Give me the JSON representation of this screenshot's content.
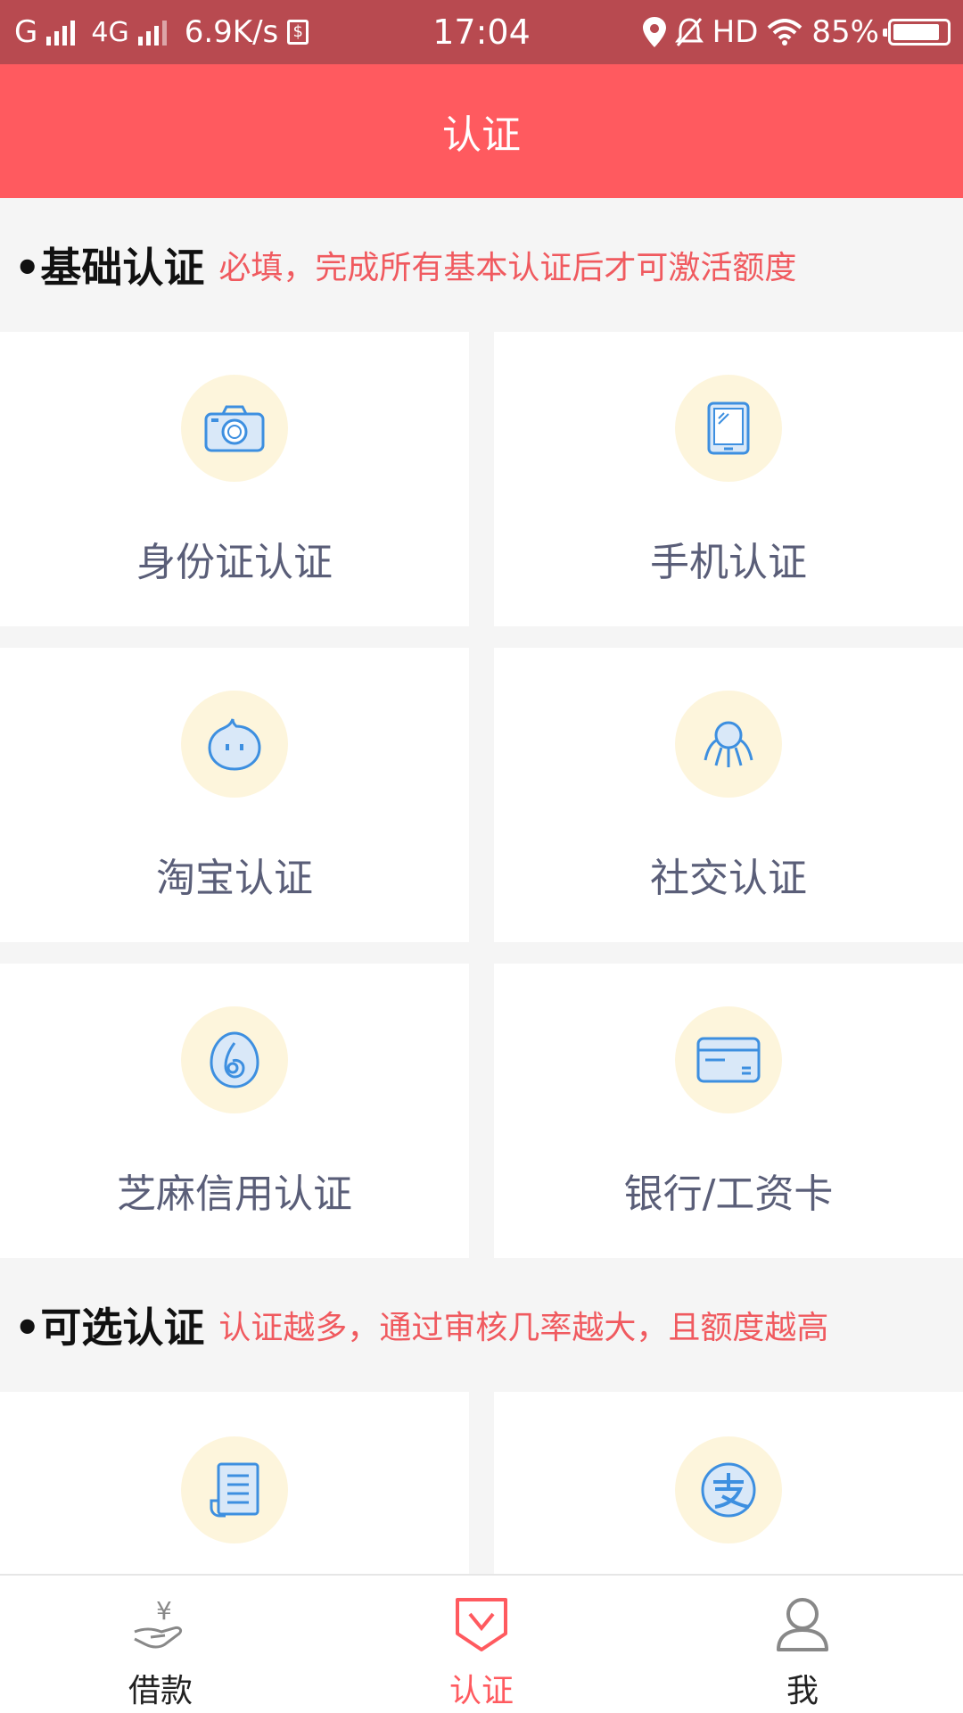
{
  "status_bar": {
    "carrier1": "G",
    "carrier2": "4G",
    "speed": "6.9K/s",
    "time": "17:04",
    "hd": "HD",
    "battery": "85%"
  },
  "header": {
    "title": "认证"
  },
  "sections": {
    "basic": {
      "title": "•基础认证",
      "note": "必填，完成所有基本认证后才可激活额度"
    },
    "optional": {
      "title": "•可选认证",
      "note": "认证越多，通过审核几率越大，且额度越高"
    }
  },
  "cards": {
    "id_card": {
      "label": "身份证认证",
      "icon": "camera-icon"
    },
    "phone": {
      "label": "手机认证",
      "icon": "phone-icon"
    },
    "taobao": {
      "label": "淘宝认证",
      "icon": "taobao-icon"
    },
    "social": {
      "label": "社交认证",
      "icon": "social-icon"
    },
    "sesame": {
      "label": "芝麻信用认证",
      "icon": "sesame-icon"
    },
    "bank": {
      "label": "银行/工资卡",
      "icon": "bank-card-icon"
    },
    "optional_1": {
      "icon": "document-icon"
    },
    "optional_2": {
      "icon": "alipay-icon"
    }
  },
  "bottom_nav": {
    "items": [
      {
        "label": "借款",
        "icon": "loan-icon",
        "active": false
      },
      {
        "label": "认证",
        "icon": "verify-icon",
        "active": true
      },
      {
        "label": "我",
        "icon": "profile-icon",
        "active": false
      }
    ]
  },
  "colors": {
    "header": "#ff5a5f",
    "status_bar": "#b84a50",
    "note": "#f05a5f",
    "icon_blue": "#3d8fe0",
    "icon_bg": "#fdf5dc"
  }
}
